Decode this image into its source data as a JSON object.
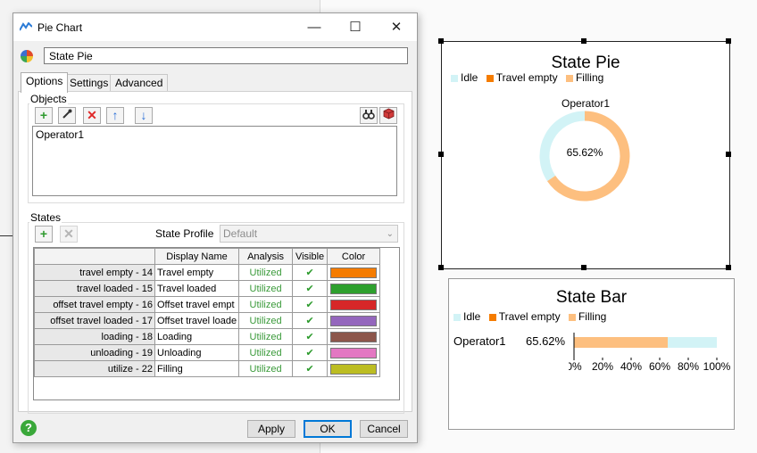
{
  "dialog": {
    "title": "Pie Chart",
    "name_value": "State Pie",
    "tabs": [
      {
        "label": "Options"
      },
      {
        "label": "Settings"
      },
      {
        "label": "Advanced"
      }
    ],
    "objects_label": "Objects",
    "objects": [
      "Operator1"
    ],
    "states_label": "States",
    "state_profile_label": "State Profile",
    "state_profile_value": "Default",
    "table": {
      "headers": [
        "Display Name",
        "Analysis",
        "Visible",
        "Color"
      ],
      "rows": [
        {
          "state": "travel empty - 14",
          "display": "Travel empty",
          "analysis": "Utilized",
          "visible": "✔",
          "color": "#f57c00"
        },
        {
          "state": "travel loaded - 15",
          "display": "Travel loaded",
          "analysis": "Utilized",
          "visible": "✔",
          "color": "#2ea02e"
        },
        {
          "state": "offset travel empty - 16",
          "display": "Offset travel empt",
          "analysis": "Utilized",
          "visible": "✔",
          "color": "#d62728"
        },
        {
          "state": "offset travel loaded - 17",
          "display": "Offset travel loade",
          "analysis": "Utilized",
          "visible": "✔",
          "color": "#9467bd"
        },
        {
          "state": "loading - 18",
          "display": "Loading",
          "analysis": "Utilized",
          "visible": "✔",
          "color": "#8c564b"
        },
        {
          "state": "unloading - 19",
          "display": "Unloading",
          "analysis": "Utilized",
          "visible": "✔",
          "color": "#e377c2"
        },
        {
          "state": "utilize - 22",
          "display": "Filling",
          "analysis": "Utilized",
          "visible": "✔",
          "color": "#bcbd22"
        }
      ]
    },
    "buttons": {
      "apply": "Apply",
      "ok": "OK",
      "cancel": "Cancel"
    }
  },
  "pie_chart": {
    "title": "State Pie",
    "legend": [
      {
        "label": "Idle",
        "color": "#d2f3f6"
      },
      {
        "label": "Travel empty",
        "color": "#f57c00"
      },
      {
        "label": "Filling",
        "color": "#fdbf7f"
      }
    ],
    "object_label": "Operator1",
    "center_text": "65.62%"
  },
  "bar_chart": {
    "title": "State Bar",
    "legend": [
      {
        "label": "Idle",
        "color": "#d2f3f6"
      },
      {
        "label": "Travel empty",
        "color": "#f57c00"
      },
      {
        "label": "Filling",
        "color": "#fdbf7f"
      }
    ],
    "row_label": "Operator1",
    "row_value": "65.62%",
    "ticks": [
      "0%",
      "20%",
      "40%",
      "60%",
      "80%",
      "100%"
    ]
  },
  "chart_data": [
    {
      "type": "pie",
      "title": "State Pie",
      "categories": [
        "Idle",
        "Filling"
      ],
      "values": [
        34.38,
        65.62
      ],
      "colors": [
        "#d2f3f6",
        "#fdbf7f"
      ]
    },
    {
      "type": "bar",
      "title": "State Bar",
      "categories": [
        "Operator1"
      ],
      "series": [
        {
          "name": "Filling",
          "values": [
            65.62
          ]
        },
        {
          "name": "Idle",
          "values": [
            34.38
          ]
        }
      ],
      "xlim": [
        0,
        100
      ]
    }
  ]
}
